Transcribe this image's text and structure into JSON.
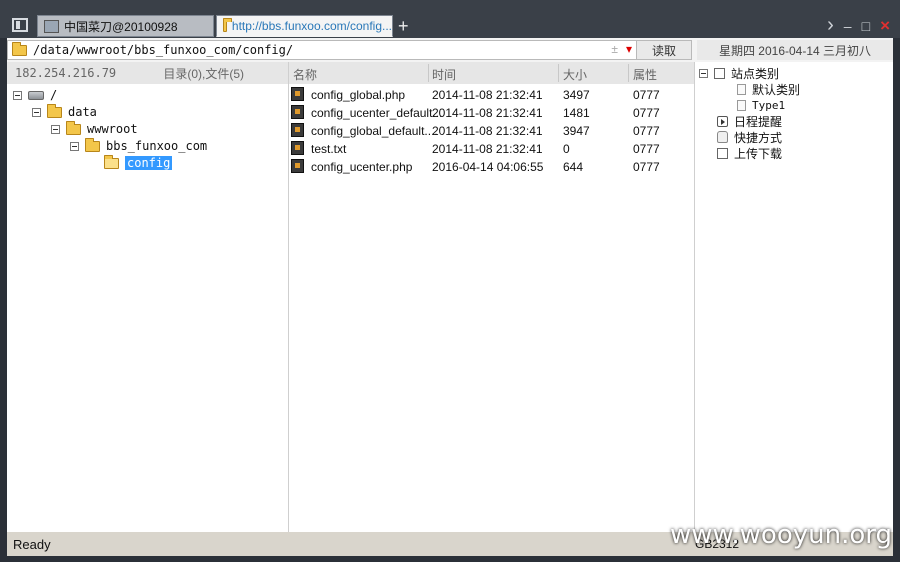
{
  "tabs": [
    {
      "label": "中国菜刀@20100928",
      "active": false
    },
    {
      "label": "http://bbs.funxoo.com/config...",
      "active": true
    }
  ],
  "window_controls": {
    "next": "›",
    "minimize": "–",
    "maximize": "□",
    "close": "×",
    "new_tab": "+"
  },
  "address": {
    "path": "/data/wwwroot/bbs_funxoo_com/config/",
    "plus": "±",
    "dropdown": "▾"
  },
  "read_button": "读取",
  "date": "星期四 2016-04-14 三月初八",
  "left": {
    "ip": "182.254.216.79",
    "counts": "目录(0),文件(5)",
    "tree": [
      {
        "label": "/",
        "level": 0,
        "type": "drive"
      },
      {
        "label": "data",
        "level": 1,
        "type": "folder"
      },
      {
        "label": "wwwroot",
        "level": 2,
        "type": "folder"
      },
      {
        "label": "bbs_funxoo_com",
        "level": 3,
        "type": "folder"
      },
      {
        "label": "config",
        "level": 4,
        "type": "folder",
        "selected": true
      }
    ]
  },
  "columns": {
    "name": "名称",
    "time": "时间",
    "size": "大小",
    "attr": "属性"
  },
  "files": [
    {
      "name": "config_global.php",
      "time": "2014-11-08 21:32:41",
      "size": "3497",
      "attr": "0777"
    },
    {
      "name": "config_ucenter_default...",
      "time": "2014-11-08 21:32:41",
      "size": "1481",
      "attr": "0777"
    },
    {
      "name": "config_global_default....",
      "time": "2014-11-08 21:32:41",
      "size": "3947",
      "attr": "0777"
    },
    {
      "name": "test.txt",
      "time": "2014-11-08 21:32:41",
      "size": "0",
      "attr": "0777"
    },
    {
      "name": "config_ucenter.php",
      "time": "2016-04-14 04:06:55",
      "size": "644",
      "attr": "0777"
    }
  ],
  "right_tree": {
    "site_category": "站点类别",
    "default_category": "默认类别",
    "type1": "Type1",
    "schedule": "日程提醒",
    "shortcuts": "快捷方式",
    "upload_download": "上传下载"
  },
  "status": {
    "text": "Ready",
    "encoding": "GB2312"
  },
  "watermark": "www.wooyun.org"
}
